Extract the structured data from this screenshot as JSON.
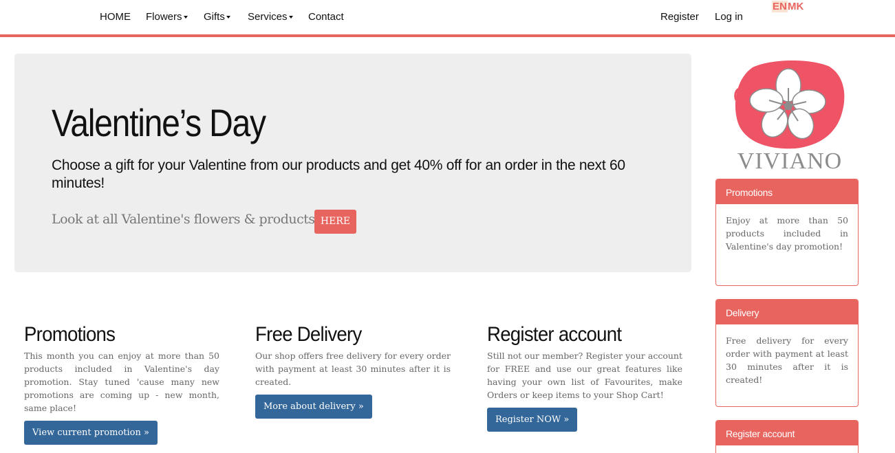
{
  "nav": {
    "home": "HOME",
    "flowers": "Flowers",
    "gifts": "Gifts",
    "services": "Services",
    "contact": "Contact",
    "register": "Register",
    "login": "Log in",
    "lang_en": "EN",
    "lang_mk": "MK"
  },
  "jumbotron": {
    "title": "Valentine’s Day",
    "lead": "Choose a gift for your Valentine from our products and get 40% off for an order in the next 60 minutes!",
    "link_text": "Look at all Valentine's flowers & products",
    "button": "HERE"
  },
  "columns": [
    {
      "title": "Promotions",
      "text": "This month you can enjoy at more than 50 products included in Valentine's day promotion. Stay tuned 'cause many new promotions are coming up - new month, same place!",
      "button": "View current promotion »"
    },
    {
      "title": "Free Delivery",
      "text": "Our shop offers free delivery for every order with payment at least 30 minutes after it is created.",
      "button": "More about delivery »"
    },
    {
      "title": "Register account",
      "text": "Still not our member? Register your account for FREE and use our great features like having your own list of Favourites, make Orders or keep items to your Shop Cart!",
      "button": "Register NOW »"
    }
  ],
  "sidebar": {
    "logo_text": "VIVIANO",
    "panels": [
      {
        "heading": "Promotions",
        "body": "Enjoy at more than 50 products included in Valentine's day promotion!"
      },
      {
        "heading": "Delivery",
        "body": "Free delivery for every order with payment at least 30 minutes after it is created!"
      },
      {
        "heading": "Register account",
        "body": ""
      }
    ]
  },
  "colors": {
    "accent": "#e8655f",
    "button_blue": "#336699",
    "jumbotron_bg": "#eeeeee",
    "logo_grey": "#8c8c8c"
  }
}
